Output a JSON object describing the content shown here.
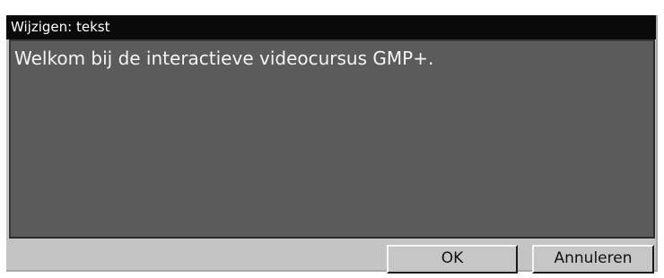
{
  "window": {
    "title": "Wijzigen: tekst"
  },
  "editor": {
    "value": "Welkom bij de interactieve videocursus GMP+."
  },
  "buttons": {
    "ok_label": "OK",
    "cancel_label": "Annuleren"
  },
  "colors": {
    "titlebar": "#0a0a0a",
    "dialog_background": "#c4c4c4",
    "text_area_background": "#5b5b5b",
    "text_color": "#f4f4f4"
  }
}
